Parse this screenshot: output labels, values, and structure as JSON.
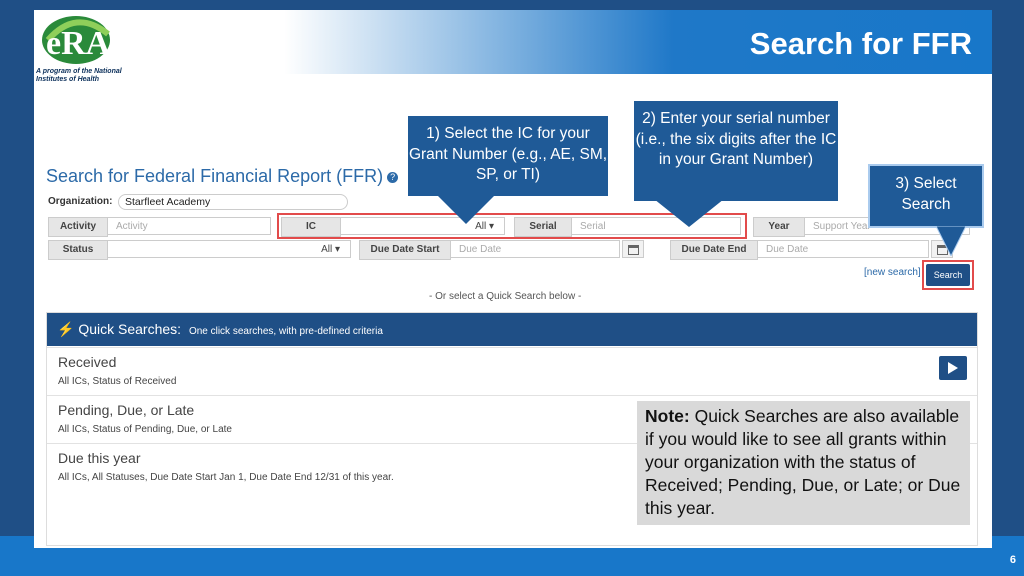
{
  "header": {
    "title": "Search for FFR",
    "logo_text": "eRA",
    "logo_subtitle": "A program of the National Institutes of Health"
  },
  "page_number": "6",
  "form": {
    "title": "Search for Federal Financial Report (FFR)",
    "help_glyph": "?",
    "organization_label": "Organization:",
    "organization_value": "Starfleet Academy",
    "row1": {
      "activity_label": "Activity",
      "activity_placeholder": "Activity",
      "ic_label": "IC",
      "ic_value": "All ▾",
      "serial_label": "Serial",
      "serial_placeholder": "Serial",
      "year_label": "Year",
      "year_placeholder": "Support Year"
    },
    "row2": {
      "status_label": "Status",
      "status_value": "All ▾",
      "due_start_label": "Due Date Start",
      "due_start_placeholder": "Due Date",
      "due_end_label": "Due Date End",
      "due_end_placeholder": "Due Date"
    },
    "new_search": "[new search]",
    "search_button": "Search",
    "or_text": "- Or select a Quick Search below -"
  },
  "quick_searches": {
    "icon": "⚡",
    "title": "Quick Searches:",
    "subtitle": "One click searches, with pre-defined criteria",
    "items": [
      {
        "title": "Received",
        "desc": "All ICs, Status of Received"
      },
      {
        "title": "Pending, Due, or Late",
        "desc": "All ICs, Status of Pending, Due, or Late"
      },
      {
        "title": "Due this year",
        "desc": "All ICs, All Statuses, Due Date Start Jan 1, Due Date End 12/31 of this year."
      }
    ]
  },
  "callouts": {
    "c1": "1) Select the IC for your Grant Number (e.g., AE, SM, SP, or TI)",
    "c2": "2) Enter your serial number (i.e., the six digits after the IC in your Grant Number)",
    "c3": "3) Select Search"
  },
  "note": {
    "label": "Note:",
    "text": " Quick Searches are also available if you would like to see all grants within your organization with the status of Received; Pending, Due, or Late; or Due this year."
  },
  "colors": {
    "primary": "#1f4f86",
    "accent": "#1877c9",
    "highlight": "#e24b4b"
  }
}
